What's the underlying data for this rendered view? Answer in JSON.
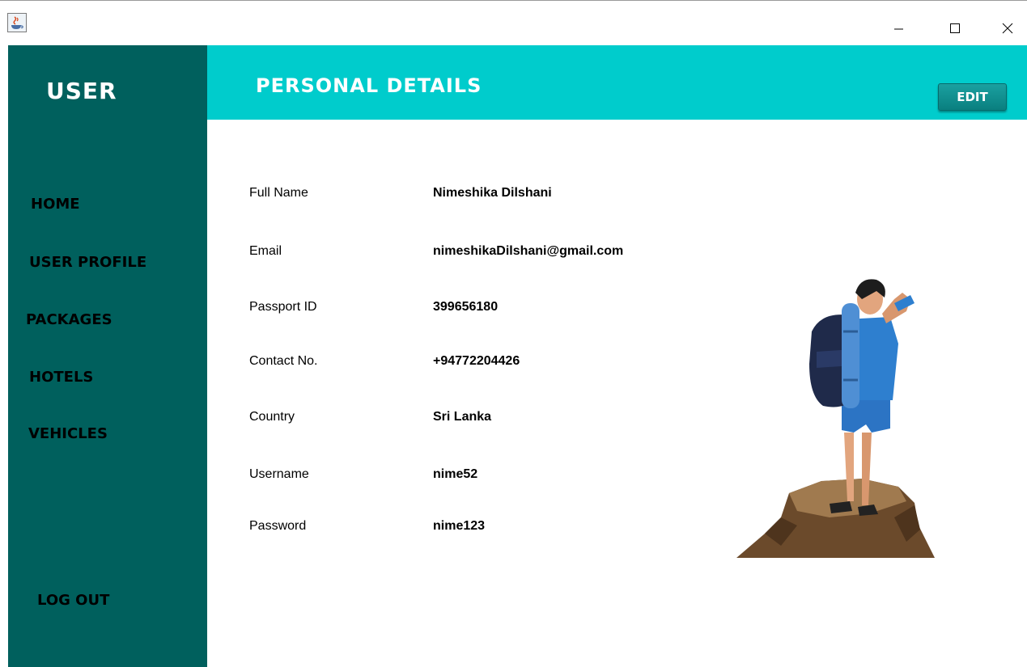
{
  "window": {
    "controls": {
      "minimize_icon": "minimize-icon",
      "maximize_icon": "maximize-icon",
      "close_icon": "close-icon"
    }
  },
  "sidebar": {
    "title": "USER",
    "items": [
      {
        "label": "HOME"
      },
      {
        "label": "USER PROFILE"
      },
      {
        "label": "PACKAGES"
      },
      {
        "label": "HOTELS"
      },
      {
        "label": "VEHICLES"
      }
    ],
    "logout_label": "LOG OUT"
  },
  "header": {
    "title": "PERSONAL DETAILS",
    "edit_label": "EDIT"
  },
  "details": [
    {
      "label": "Full Name",
      "value": "Nimeshika Dilshani"
    },
    {
      "label": "Email",
      "value": "nimeshikaDilshani@gmail.com"
    },
    {
      "label": "Passport ID",
      "value": "399656180"
    },
    {
      "label": "Contact No.",
      "value": "+94772204426"
    },
    {
      "label": "Country",
      "value": "Sri Lanka"
    },
    {
      "label": "Username",
      "value": "nime52"
    },
    {
      "label": "Password",
      "value": "nime123"
    }
  ],
  "colors": {
    "sidebar": "#00605d",
    "header": "#00cccc",
    "edit_button": "#0a7f7f"
  },
  "illustration": "hiker-on-rock-illustration"
}
